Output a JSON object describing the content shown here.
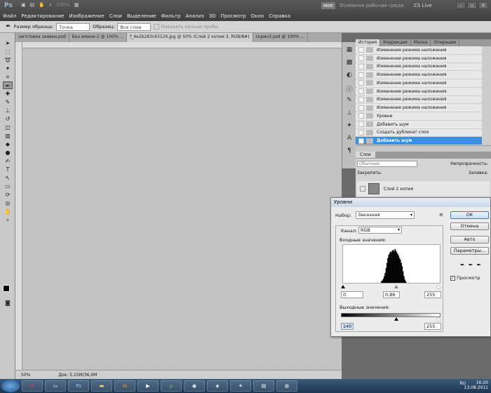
{
  "app": {
    "logo": "Ps",
    "menu": [
      "Файл",
      "Редактирование",
      "Изображение",
      "Слои",
      "Выделение",
      "Фильтр",
      "Анализ",
      "3D",
      "Просмотр",
      "Окно",
      "Справка"
    ],
    "zoom": "100%",
    "workspace_btn": "мое",
    "workspace_name": "Основная рабочая среда",
    "cs_live": "CS Live"
  },
  "options": {
    "sample_size_label": "Размер образца:",
    "sample_size_value": "Точка",
    "sample_label": "Образец:",
    "sample_value": "Все слои",
    "show_ring": "Показать кольцо пробы"
  },
  "tabs": [
    "заготовка заявки.psd",
    "Без имени-2 @ 100% ...",
    "f_4e2b283c63126.jpg @ 50% (Слой 2 копия 3, RGB/8#)",
    "скрин3.psd @ 100% ..."
  ],
  "status": {
    "zoom": "50%",
    "doc": "Док: 5,15M/36,0M"
  },
  "panel_tabs": [
    "История",
    "Коррекция",
    "Маски",
    "Операции"
  ],
  "history": [
    "Изменение режима наложения",
    "Изменение режима наложения",
    "Изменение режима наложения",
    "Изменение режима наложения",
    "Изменение режима наложения",
    "Изменение режима наложения",
    "Изменение режима наложения",
    "Изменение режима наложения",
    "Уровни",
    "Добавить шум",
    "Создать дубликат слоя",
    "Добавить шум"
  ],
  "layers": {
    "tab": "Слои",
    "blend": "Обычные",
    "opacity_label": "Непрозрачность:",
    "lock_label": "Закрепить:",
    "fill_label": "Заливка:",
    "layer_name": "Слой 2 копия"
  },
  "levels": {
    "title": "Уровни",
    "preset_label": "Набор:",
    "preset_value": "Заказная",
    "channel_label": "Канал:",
    "channel_value": "RGB",
    "input_label": "Входные значения:",
    "in_black": "0",
    "in_gamma": "0,86",
    "in_white": "255",
    "output_label": "Выходные значения:",
    "out_black": "140",
    "out_white": "255",
    "btn_ok": "OK",
    "btn_cancel": "Отмена",
    "btn_auto": "Авто",
    "btn_params": "Параметры...",
    "preview": "Просмотр",
    "histogram": [
      2,
      3,
      5,
      8,
      12,
      18,
      24,
      30,
      34,
      36,
      38,
      37,
      39,
      40,
      38,
      41,
      39,
      37,
      35,
      33,
      30,
      28,
      24,
      20,
      14,
      8,
      4,
      2
    ]
  },
  "taskbar": {
    "lang": "RU",
    "time": "16:20",
    "date": "13.08.2011"
  }
}
